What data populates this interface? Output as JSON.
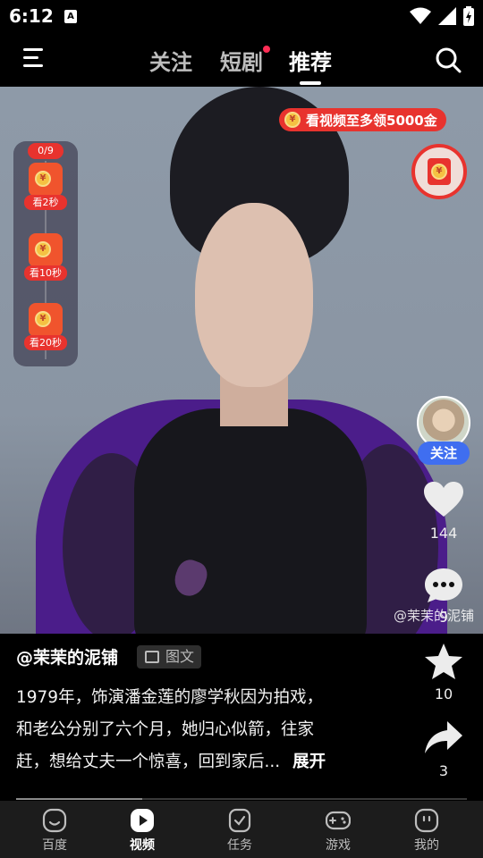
{
  "status_bar": {
    "time": "6:12",
    "app_badge": "A"
  },
  "top_nav": {
    "tabs": [
      {
        "label": "关注"
      },
      {
        "label": "短剧",
        "has_dot": true
      },
      {
        "label": "推荐",
        "active": true
      }
    ]
  },
  "reward": {
    "banner_text": "看视频至多领5000金",
    "coin_glyph": "¥",
    "tasks": {
      "count": "0/9",
      "items": [
        {
          "label": "看2秒"
        },
        {
          "label": "看10秒"
        },
        {
          "label": "看20秒"
        }
      ]
    }
  },
  "video": {
    "watermark": "@茉茉的泥铺"
  },
  "actions": {
    "follow_label": "关注",
    "likes": "144",
    "comments": "9",
    "favorites": "10",
    "shares": "3"
  },
  "post": {
    "author": "@茉茉的泥铺",
    "tag": "图文",
    "caption_lines": [
      "1979年，饰演潘金莲的廖学秋因为拍戏，",
      "和老公分别了六个月，她归心似箭，往家",
      "赶，想给丈夫一个惊喜，回到家后..."
    ],
    "expand_label": "展开",
    "progress": 0.28
  },
  "bottom_nav": {
    "items": [
      {
        "label": "百度",
        "icon": "baidu-face-icon"
      },
      {
        "label": "视频",
        "icon": "video-play-icon",
        "active": true
      },
      {
        "label": "任务",
        "icon": "task-check-icon"
      },
      {
        "label": "游戏",
        "icon": "gamepad-icon"
      },
      {
        "label": "我的",
        "icon": "profile-face-icon"
      }
    ]
  },
  "colors": {
    "accent_red": "#e8332e",
    "follow_blue": "#3f6ef0",
    "nav_bg": "#1c1c1c"
  }
}
